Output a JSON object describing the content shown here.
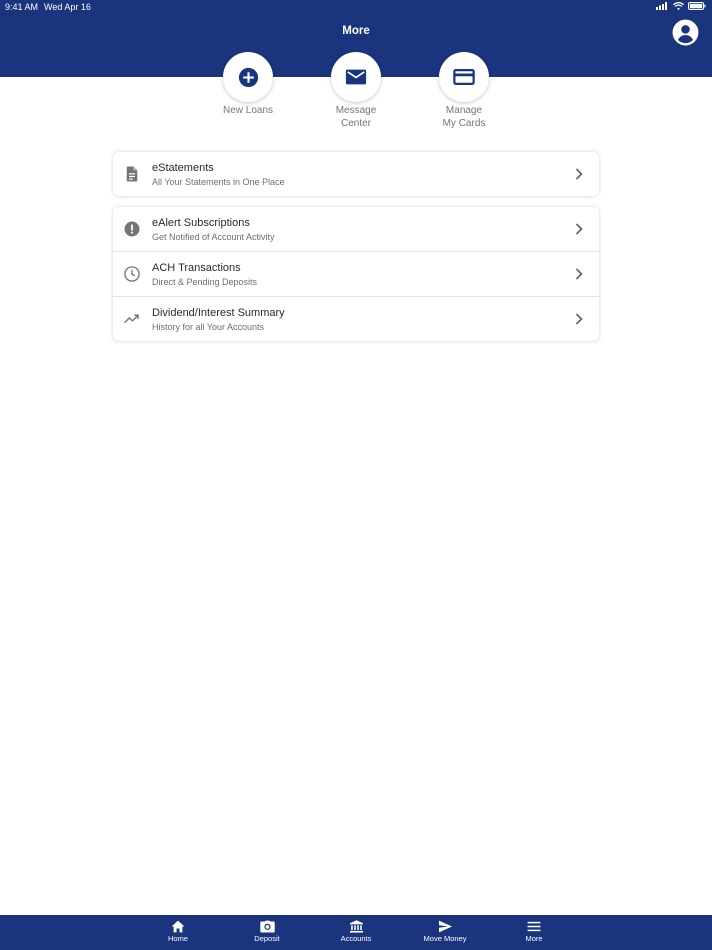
{
  "status_bar": {
    "time": "9:41 AM",
    "date": "Wed Apr 16"
  },
  "header": {
    "title": "More"
  },
  "quick_actions": [
    {
      "label": "New Loans",
      "icon": "plus-circle-icon"
    },
    {
      "label": "Message\nCenter",
      "icon": "mail-icon"
    },
    {
      "label": "Manage\nMy Cards",
      "icon": "credit-card-icon"
    }
  ],
  "menu_groups": [
    {
      "items": [
        {
          "title": "eStatements",
          "subtitle": "All Your Statements in One Place",
          "icon": "document-icon"
        }
      ]
    },
    {
      "items": [
        {
          "title": "eAlert Subscriptions",
          "subtitle": "Get Notified of Account Activity",
          "icon": "alert-icon"
        },
        {
          "title": "ACH Transactions",
          "subtitle": "Direct & Pending Deposits",
          "icon": "clock-icon"
        },
        {
          "title": "Dividend/Interest Summary",
          "subtitle": "History for all Your Accounts",
          "icon": "trending-up-icon"
        }
      ]
    }
  ],
  "tab_bar": {
    "tabs": [
      {
        "label": "Home",
        "icon": "home-icon"
      },
      {
        "label": "Deposit",
        "icon": "camera-icon"
      },
      {
        "label": "Accounts",
        "icon": "bank-icon"
      },
      {
        "label": "Move Money",
        "icon": "send-icon"
      },
      {
        "label": "More",
        "icon": "menu-icon",
        "active": true
      }
    ]
  },
  "colors": {
    "brand": "#1a347e",
    "icon_gray": "#757575",
    "background": "#ffffff"
  }
}
